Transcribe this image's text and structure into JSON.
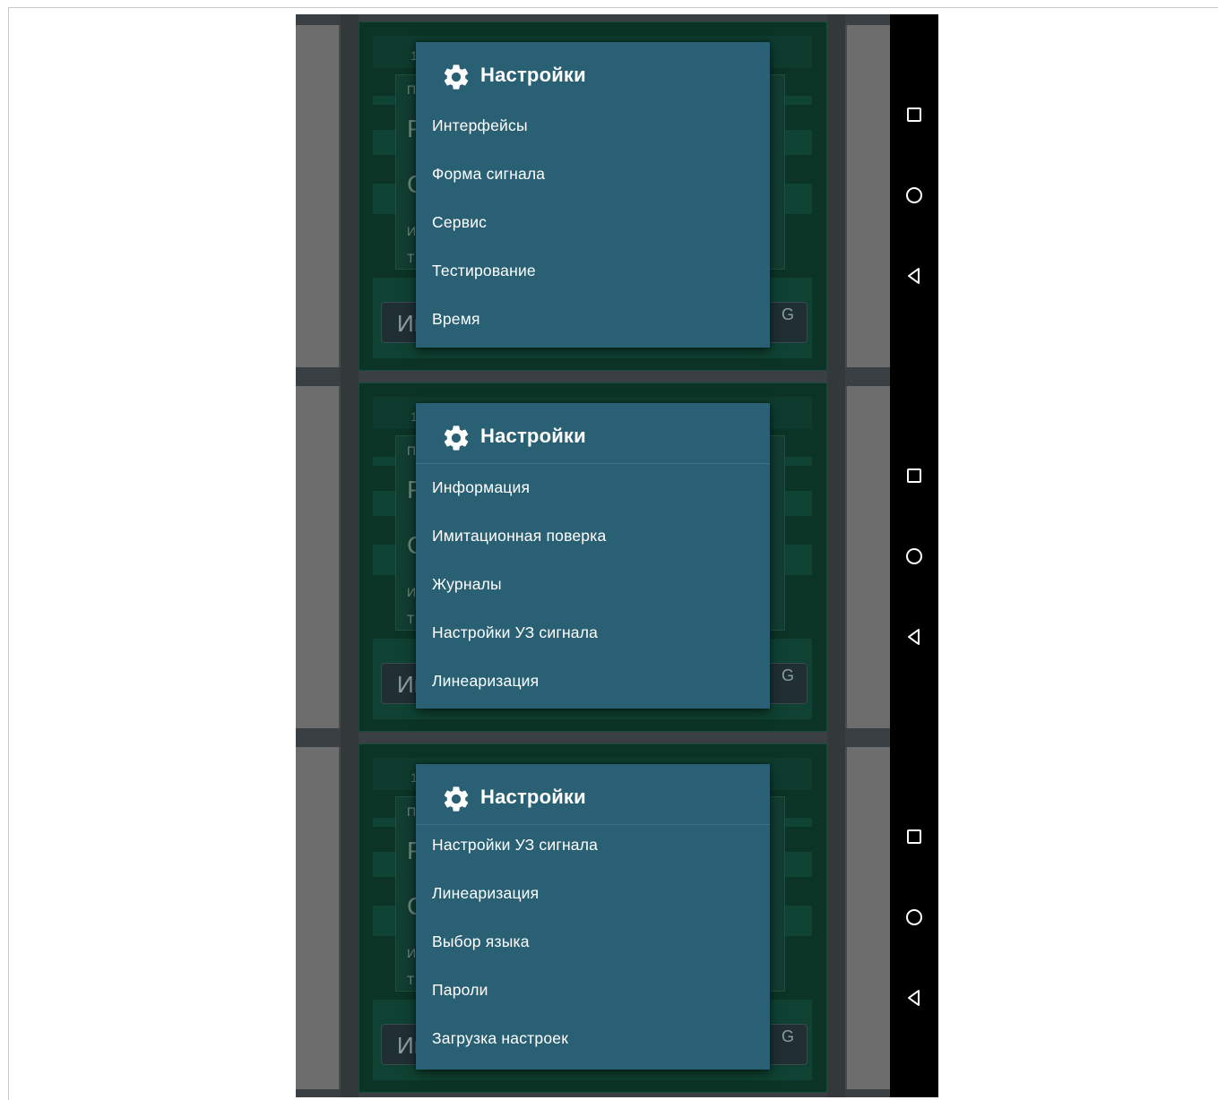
{
  "dialogs": [
    {
      "title": "Настройки",
      "icon": "gear-icon",
      "items": [
        "Интерфейсы",
        "Форма сигнала",
        "Сервис",
        "Тестирование",
        "Время"
      ]
    },
    {
      "title": "Настройки",
      "icon": "gear-icon",
      "items": [
        "Информация",
        "Имитационная поверка",
        "Журналы",
        "Настройки УЗ сигнала",
        "Линеаризация"
      ]
    },
    {
      "title": "Настройки",
      "icon": "gear-icon",
      "items": [
        "Настройки УЗ сигнала",
        "Линеаризация",
        "Выбор языка",
        "Пароли",
        "Загрузка настроек"
      ]
    }
  ],
  "background_app": {
    "topbar_number": "1",
    "panel_letters": [
      "П",
      "Р",
      "С",
      "И",
      "Т"
    ],
    "button_left_text": "Ин",
    "button_right_text": "G"
  },
  "navbar": {
    "buttons": [
      "recent-apps-icon",
      "home-icon",
      "back-icon"
    ]
  },
  "colors": {
    "dialog_bg": "#2a6073",
    "app_bg": "#0b3326",
    "navbar_bg": "#000000"
  }
}
